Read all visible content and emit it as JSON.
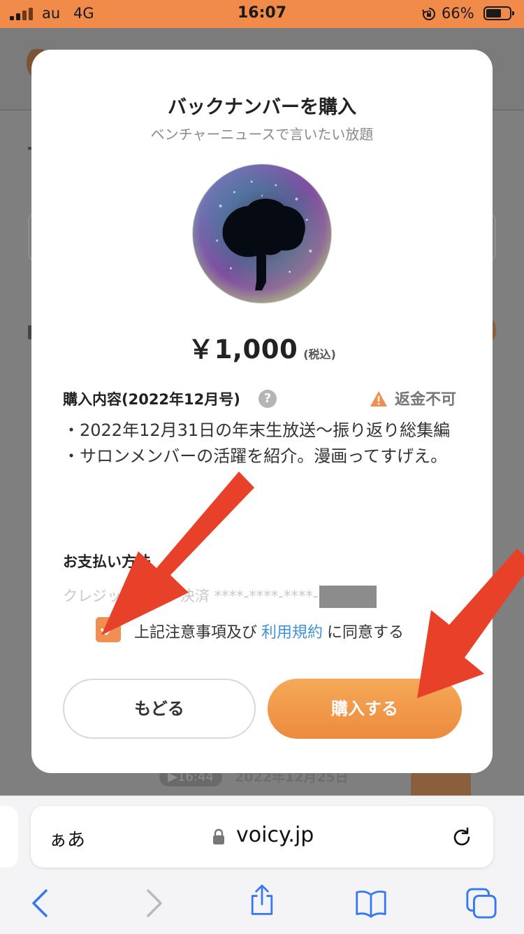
{
  "status_bar": {
    "carrier": "au",
    "network": "4G",
    "time": "16:07",
    "battery": "66%",
    "battery_level": 0.66,
    "icons": [
      "signal-icon",
      "rotation-lock-icon",
      "battery-icon"
    ]
  },
  "background": {
    "episode_duration": "▶16:44",
    "episode_date": "2022年12月25日"
  },
  "modal": {
    "title": "バックナンバーを購入",
    "subtitle": "ベンチャーニュースで言いたい放題",
    "price": "￥1,000",
    "tax_note": "(税込)",
    "details_title": "購入内容(2022年12月号)",
    "help_icon": "?",
    "no_refund": "返金不可",
    "details_line1": "・2022年12月31日の年末生放送〜振り返り総集編",
    "details_line2": "・サロンメンバーの活躍を紹介。漫画ってすげえ。",
    "payment_title": "お支払い方法",
    "payment_method": "クレジットカード決済 ****-****-****-",
    "agree_checked": true,
    "agree_prefix": "上記注意事項及び",
    "agree_link": "利用規約",
    "agree_suffix": "に同意する",
    "back_button": "もどる",
    "buy_button": "購入する"
  },
  "browser": {
    "aa_label": "ぁあ",
    "url": "voicy.jp",
    "nav": [
      "back-icon",
      "forward-icon",
      "share-icon",
      "bookmarks-icon",
      "tabs-icon"
    ]
  },
  "colors": {
    "accent_orange": "#ef8f52",
    "status_bar": "#f08b4a",
    "link_blue": "#3f93d6",
    "ios_blue": "#3478f6",
    "annotation_red": "#e8412a"
  }
}
